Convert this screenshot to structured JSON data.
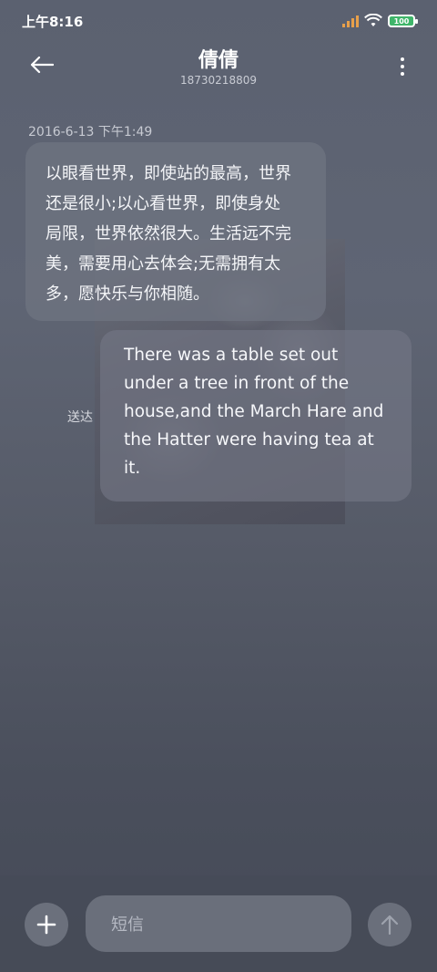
{
  "status_bar": {
    "time": "上午8:16",
    "battery": "100",
    "icons": [
      "signal-icon",
      "wifi-icon",
      "battery-icon"
    ]
  },
  "header": {
    "title": "倩倩",
    "phone": "18730218809",
    "icons": [
      "back-arrow-icon",
      "more-vertical-icon"
    ]
  },
  "conversation": {
    "timestamp": "2016-6-13 下午1:49",
    "incoming": {
      "lines": [
        "以眼看世界，即使站的最高，世界",
        "还是很小;以心看世界，即使身处",
        "局限，世界依然很大。生活远不完",
        "美，需要用心去体会;无需拥有太",
        "多，愿快乐与你相随。"
      ]
    },
    "outgoing": {
      "lines": [
        "There was a table set out",
        "under a tree in front of the",
        "house,and the March Hare and",
        "the Hatter were having tea at",
        "it."
      ],
      "status": "送达"
    }
  },
  "composer": {
    "placeholder": "短信",
    "icons": [
      "add-icon",
      "send-arrow-icon"
    ]
  },
  "colors": {
    "background": "#5b6170",
    "bubble": "#6e7380",
    "accent_signal": "#e8a04a",
    "battery_green": "#3fb56a"
  }
}
